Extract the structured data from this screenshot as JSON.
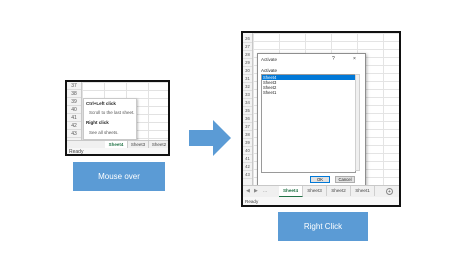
{
  "left_screenshot": {
    "row_numbers": [
      "37",
      "38",
      "39",
      "40",
      "41",
      "42",
      "43"
    ],
    "tooltip": {
      "line1": "Ctrl+Left click",
      "line2": "Scroll to the last sheet.",
      "line3": "Right click",
      "line4": "See all sheets."
    },
    "tabs": [
      "Sheet4",
      "Sheet3",
      "Sheet2"
    ],
    "active_tab": "Sheet4",
    "status": "Ready"
  },
  "arrow_color": "#5b9bd5",
  "caption_left": "Mouse over",
  "caption_right": "Right Click",
  "caption_color": "#5b9bd5",
  "right_screenshot": {
    "row_numbers": [
      "26",
      "27",
      "28",
      "29",
      "30",
      "31",
      "32",
      "33",
      "34",
      "35",
      "36",
      "37",
      "38",
      "39",
      "40",
      "41",
      "42",
      "43"
    ],
    "dialog": {
      "title": "Activate",
      "help": "?",
      "close": "×",
      "label": "Activate",
      "sheets": [
        "Sheet4",
        "Sheet3",
        "Sheet2",
        "Sheet1"
      ],
      "selected": "Sheet4",
      "ok": "OK",
      "cancel": "Cancel"
    },
    "nav_prev": "◀",
    "nav_next": "▶",
    "nav_more": "...",
    "tabs": [
      "Sheet4",
      "Sheet3",
      "Sheet2",
      "Sheet1"
    ],
    "active_tab": "Sheet4",
    "add_sheet": "+",
    "status": "Ready"
  }
}
